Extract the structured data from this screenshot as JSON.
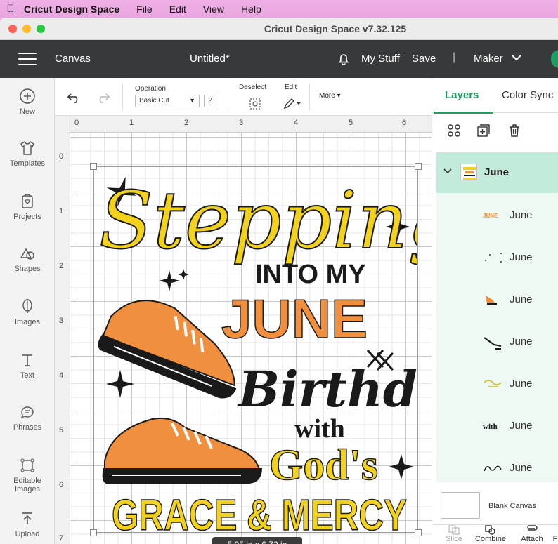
{
  "menubar": {
    "app_name": "Cricut Design Space",
    "items": [
      "File",
      "Edit",
      "View",
      "Help"
    ]
  },
  "window": {
    "title": "Cricut Design Space  v7.32.125"
  },
  "header": {
    "canvas_label": "Canvas",
    "doc_title": "Untitled*",
    "my_stuff": "My Stuff",
    "save": "Save",
    "separator": "|",
    "machine": "Maker"
  },
  "sidebar": {
    "items": [
      {
        "label": "New",
        "icon": "plus-circle-icon"
      },
      {
        "label": "Templates",
        "icon": "shirt-icon"
      },
      {
        "label": "Projects",
        "icon": "projects-icon"
      },
      {
        "label": "Shapes",
        "icon": "shapes-icon"
      },
      {
        "label": "Images",
        "icon": "balloon-icon"
      },
      {
        "label": "Text",
        "icon": "text-icon"
      },
      {
        "label": "Phrases",
        "icon": "speech-bubble-icon"
      },
      {
        "label": "Editable Images",
        "icon": "editable-images-icon"
      },
      {
        "label": "Upload",
        "icon": "upload-icon"
      }
    ]
  },
  "toolbar": {
    "operation_label": "Operation",
    "operation_value": "Basic Cut",
    "help": "?",
    "deselect_label": "Deselect",
    "edit_label": "Edit",
    "more_label": "More"
  },
  "canvas": {
    "ruler_top": [
      "0",
      "1",
      "2",
      "3",
      "4",
      "5",
      "6"
    ],
    "ruler_left": [
      "0",
      "1",
      "2",
      "3",
      "4",
      "5",
      "6",
      "7"
    ],
    "dimensions": "5.95  in x 6.72  in",
    "design": {
      "line1": "Stepping",
      "line2": "INTO MY",
      "line3": "JUNE",
      "line4": "Birthday",
      "line5": "with",
      "line6": "God's",
      "line7": "GRACE & MERCY",
      "colors": {
        "yellow": "#f2d21b",
        "orange": "#f08f3d",
        "black": "#1a1a1a"
      }
    }
  },
  "panel": {
    "tabs": [
      "Layers",
      "Color Sync"
    ],
    "group": {
      "name": "June"
    },
    "layers": [
      {
        "name": "June",
        "thumb_text": "JUNE"
      },
      {
        "name": "June"
      },
      {
        "name": "June"
      },
      {
        "name": "June"
      },
      {
        "name": "June"
      },
      {
        "name": "June",
        "thumb_text": "with"
      },
      {
        "name": "June"
      }
    ],
    "blank_canvas": "Blank Canvas",
    "bottom_tools": [
      "Slice",
      "Combine",
      "Attach",
      "F"
    ]
  },
  "colors": {
    "accent": "#1d9e60",
    "header_bg": "#38393b"
  }
}
